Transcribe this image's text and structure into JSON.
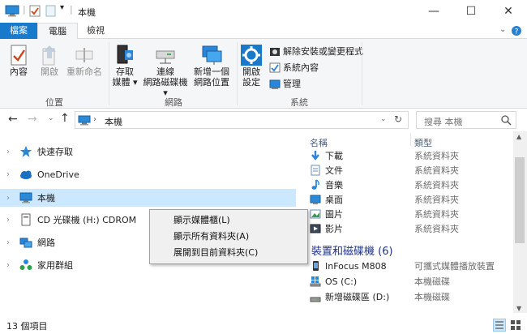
{
  "window": {
    "title": "本機",
    "controls": {
      "minimize": "—",
      "maximize": "☐",
      "close": "✕"
    }
  },
  "tabs": [
    {
      "label": "檔案",
      "active": false
    },
    {
      "label": "電腦",
      "active": true
    },
    {
      "label": "檢視",
      "active": false
    }
  ],
  "ribbon": {
    "location_group": {
      "label": "位置",
      "buttons": [
        {
          "label": "內容",
          "enabled": true
        },
        {
          "label": "開啟",
          "enabled": false
        },
        {
          "label": "重新命名",
          "enabled": false
        }
      ]
    },
    "network_group": {
      "label": "網路",
      "buttons": [
        {
          "line1": "存取",
          "line2": "媒體 ▾"
        },
        {
          "line1": "連線",
          "line2": "網路磁碟機 ▾"
        },
        {
          "line1": "新增一個",
          "line2": "網路位置"
        }
      ]
    },
    "system_group": {
      "label": "系統",
      "open_settings": {
        "line1": "開啟",
        "line2": "設定"
      },
      "small_buttons": [
        {
          "label": "解除安裝或變更程式"
        },
        {
          "label": "系統內容"
        },
        {
          "label": "管理"
        }
      ]
    }
  },
  "address": {
    "path": "本機",
    "search_placeholder": "搜尋 本機"
  },
  "nav": [
    {
      "label": "快速存取",
      "selected": false
    },
    {
      "label": "OneDrive",
      "selected": false
    },
    {
      "label": "本機",
      "selected": true
    },
    {
      "label": "CD 光碟機 (H:) CDROM",
      "selected": false
    },
    {
      "label": "網路",
      "selected": false
    },
    {
      "label": "家用群組",
      "selected": false
    }
  ],
  "content": {
    "columns": {
      "name": "名稱",
      "type": "類型"
    },
    "folders": [
      {
        "name": "下載",
        "type": "系統資料夾",
        "icon": "download-icon"
      },
      {
        "name": "文件",
        "type": "系統資料夾",
        "icon": "document-icon"
      },
      {
        "name": "音樂",
        "type": "系統資料夾",
        "icon": "music-icon"
      },
      {
        "name": "桌面",
        "type": "系統資料夾",
        "icon": "desktop-icon"
      },
      {
        "name": "圖片",
        "type": "系統資料夾",
        "icon": "picture-icon"
      },
      {
        "name": "影片",
        "type": "系統資料夾",
        "icon": "video-icon"
      }
    ],
    "devices_header": "裝置和磁碟機 (6)",
    "devices": [
      {
        "name": "InFocus M808",
        "type": "可攜式媒體播放裝置",
        "icon": "phone-icon"
      },
      {
        "name": "OS (C:)",
        "type": "本機磁碟",
        "icon": "windows-drive-icon"
      },
      {
        "name": "新增磁碟區 (D:)",
        "type": "本機磁碟",
        "icon": "drive-icon"
      }
    ]
  },
  "context_menu": [
    {
      "label": "顯示媒體櫃(L)"
    },
    {
      "label": "顯示所有資料夾(A)"
    },
    {
      "label": "展開到目前資料夾(C)"
    }
  ],
  "status": {
    "item_count": "13 個項目"
  },
  "colors": {
    "accent": "#1979ca",
    "selection": "#cce8ff",
    "section_header": "#1e3287"
  }
}
